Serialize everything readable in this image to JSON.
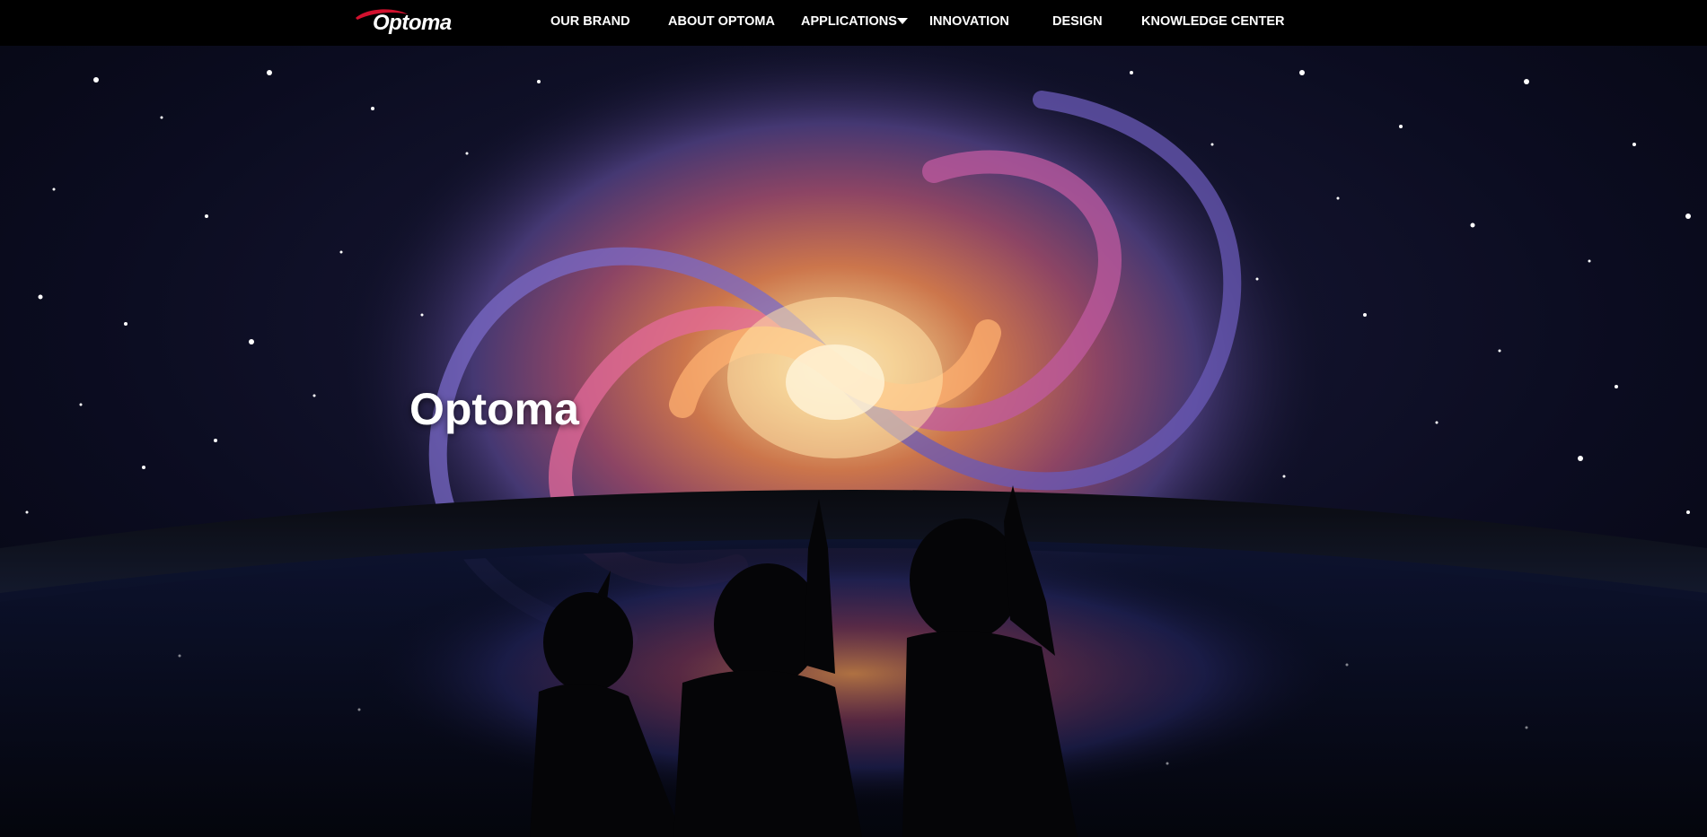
{
  "header": {
    "logo_text": "Optoma",
    "nav": [
      {
        "label": "OUR BRAND"
      },
      {
        "label": "ABOUT OPTOMA"
      },
      {
        "label": "APPLICATIONS",
        "icon": "chevron-down-icon"
      },
      {
        "label": "INNOVATION"
      },
      {
        "label": "DESIGN"
      },
      {
        "label": "KNOWLEDGE CENTER"
      }
    ]
  },
  "hero": {
    "title": "Optoma",
    "image_alt": "galaxy-projection-with-children-silhouettes"
  },
  "colors": {
    "header_bg": "#000000",
    "nav_text": "#ffffff",
    "logo_swoosh": "#d2112e"
  }
}
